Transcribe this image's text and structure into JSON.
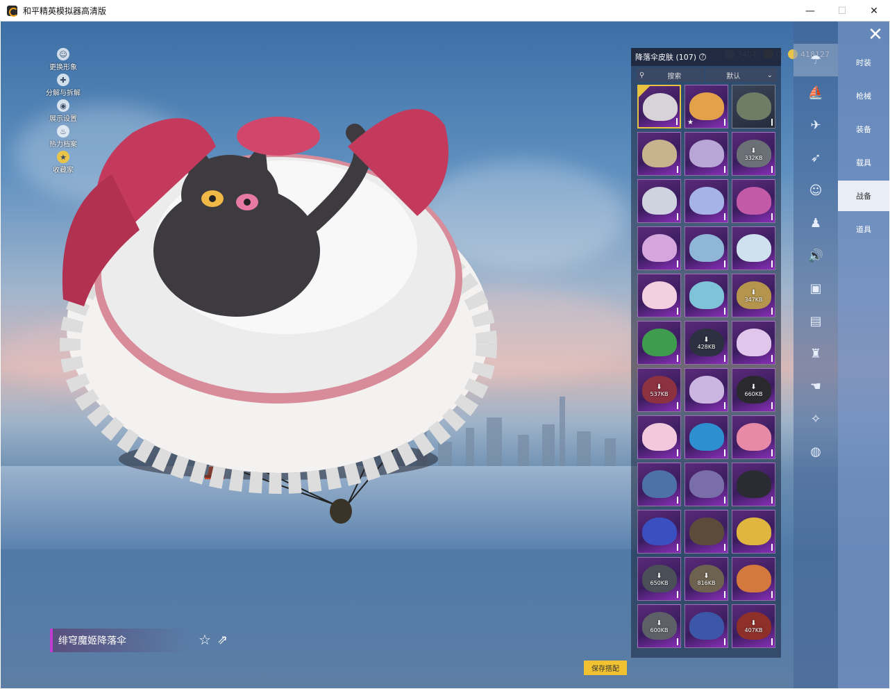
{
  "window": {
    "title": "和平精英模拟器高清版",
    "minimize_glyph": "—",
    "maximize_glyph": "☐",
    "close_glyph": "✕"
  },
  "side_tools": [
    {
      "label": "更换形象",
      "icon": "avatar-icon"
    },
    {
      "label": "分解与拆解",
      "icon": "puzzle-icon"
    },
    {
      "label": "展示设置",
      "icon": "eye-icon"
    },
    {
      "label": "热力档案",
      "icon": "flame-icon"
    },
    {
      "label": "收藏家",
      "icon": "collector-badge-icon"
    }
  ],
  "currency": [
    {
      "value": "3404",
      "icon": "coin-icon",
      "color": "#a9b3c2"
    },
    {
      "value": "0",
      "icon": "uc-icon",
      "color": "#d6a23c"
    },
    {
      "value": "418127",
      "icon": "gold-coin-icon",
      "color": "#e9c44a"
    }
  ],
  "panel": {
    "title": "降落伞皮肤 (107)",
    "search_label": "搜索",
    "sort_label": "默认"
  },
  "grid": [
    {
      "art": "#d8d3d8",
      "selected": true
    },
    {
      "art": "#e3a24a",
      "star": true
    },
    {
      "art": "#6f7d66",
      "dark": true
    },
    {
      "art": "#c7b48e"
    },
    {
      "art": "#b7a6d6"
    },
    {
      "art": "#6b6f76",
      "download": "332KB"
    },
    {
      "art": "#cfd3df"
    },
    {
      "art": "#a6b3e6"
    },
    {
      "art": "#c35aa7"
    },
    {
      "art": "#d5a6de"
    },
    {
      "art": "#8fb6d6"
    },
    {
      "art": "#cfe0ee"
    },
    {
      "art": "#f3cfe0"
    },
    {
      "art": "#7fc3d8"
    },
    {
      "art": "#b5954d",
      "download": "347KB"
    },
    {
      "art": "#3f9c4f"
    },
    {
      "art": "#2d3040",
      "download": "428KB"
    },
    {
      "art": "#e0c6ea"
    },
    {
      "art": "#8b3140",
      "download": "537KB"
    },
    {
      "art": "#cbb6e2"
    },
    {
      "art": "#2a2a2e",
      "download": "660KB"
    },
    {
      "art": "#f2c9dc"
    },
    {
      "art": "#2e8fd0"
    },
    {
      "art": "#e78aa8"
    },
    {
      "art": "#4d72a8"
    },
    {
      "art": "#7a6ea8"
    },
    {
      "art": "#2b2b33"
    },
    {
      "art": "#3a4fc0"
    },
    {
      "art": "#5c4a3a"
    },
    {
      "art": "#e0b640"
    },
    {
      "art": "#4a4f58",
      "download": "650KB"
    },
    {
      "art": "#6d6250",
      "download": "816KB"
    },
    {
      "art": "#d4793d"
    },
    {
      "art": "#5e6068",
      "download": "600KB"
    },
    {
      "art": "#3c57a8"
    },
    {
      "art": "#8e2f2a",
      "download": "407KB"
    }
  ],
  "categories": [
    {
      "icon": "parachute-icon",
      "active": true
    },
    {
      "icon": "vehicle-icon"
    },
    {
      "icon": "plane-icon"
    },
    {
      "icon": "jet-icon"
    },
    {
      "icon": "emote-icon"
    },
    {
      "icon": "robot-icon"
    },
    {
      "icon": "speaker-icon"
    },
    {
      "icon": "badge-icon"
    },
    {
      "icon": "picture-icon"
    },
    {
      "icon": "spray-icon"
    },
    {
      "icon": "hand-icon"
    },
    {
      "icon": "wand-icon"
    },
    {
      "icon": "ufo-icon"
    }
  ],
  "tabs": [
    {
      "label": "时装"
    },
    {
      "label": "枪械"
    },
    {
      "label": "装备"
    },
    {
      "label": "载具"
    },
    {
      "label": "战备",
      "active": true
    },
    {
      "label": "道具"
    }
  ],
  "item": {
    "name": "绯穹魔姬降落伞"
  },
  "save_label": "保存搭配",
  "colors": {
    "accent_gold": "#f0c232",
    "rarity_purple": "#c23bd1"
  }
}
